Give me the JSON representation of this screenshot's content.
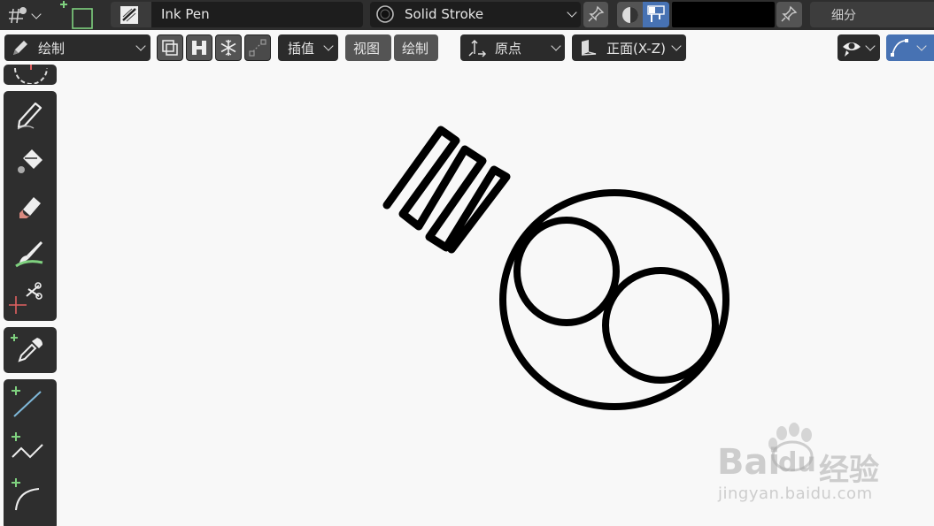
{
  "header": {
    "brush_name": "Ink Pen",
    "material_name": "Solid Stroke",
    "subdivide_label": "细分",
    "color_swatch": "#000000"
  },
  "toolbar": {
    "mode_label": "绘制",
    "interpolate_label": "插值",
    "view_label": "视图",
    "draw_label": "绘制",
    "origin_label": "原点",
    "orientation_label": "正面(X-Z)"
  },
  "watermark": {
    "brand": "Bai",
    "brand_paw_text": "du",
    "brand_cn": "经验",
    "url": "jingyan.baidu.com"
  },
  "colors": {
    "header_bg": "#2e2e2e",
    "field_bg": "#1d1d1d",
    "button_bg": "#545454",
    "active_blue": "#4772b3",
    "canvas_bg": "#f8f8f8",
    "stroke": "#000000",
    "add_green": "#7fd17f"
  },
  "tools": [
    {
      "name": "draw-tool",
      "icon": "pencil-icon"
    },
    {
      "name": "fill-tool",
      "icon": "bucket-icon"
    },
    {
      "name": "erase-tool",
      "icon": "eraser-icon"
    },
    {
      "name": "tint-tool",
      "icon": "brush-icon"
    },
    {
      "name": "cutter-tool",
      "icon": "scissors-icon"
    },
    {
      "name": "eyedropper-tool",
      "icon": "eyedropper-icon"
    },
    {
      "name": "line-tool",
      "icon": "line-icon"
    },
    {
      "name": "polyline-tool",
      "icon": "polyline-icon"
    },
    {
      "name": "arc-tool",
      "icon": "arc-icon"
    }
  ]
}
